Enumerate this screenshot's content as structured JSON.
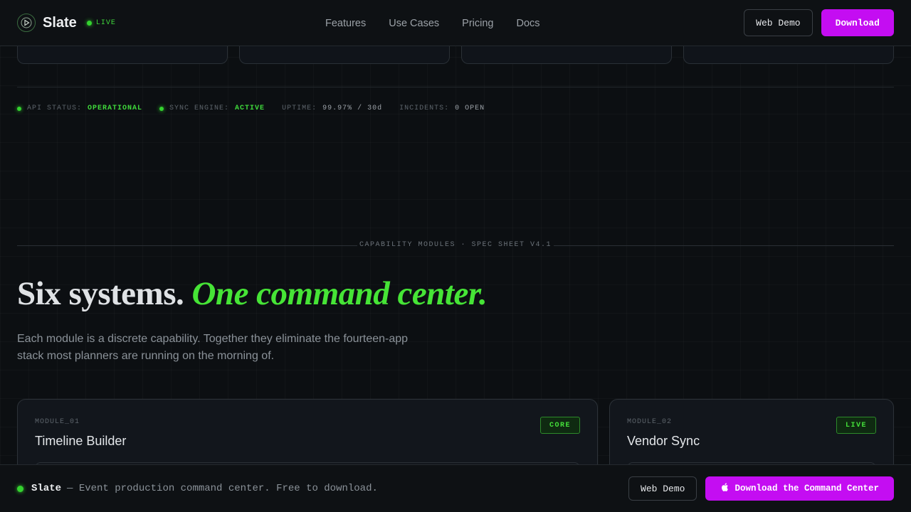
{
  "header": {
    "brand": "Slate",
    "live_label": "LIVE",
    "nav": [
      "Features",
      "Use Cases",
      "Pricing",
      "Docs"
    ],
    "web_demo_label": "Web Demo",
    "download_label": "Download"
  },
  "status": [
    {
      "label": "API STATUS:",
      "value": "OPERATIONAL",
      "dot": true
    },
    {
      "label": "SYNC ENGINE:",
      "value": "ACTIVE",
      "dot": true
    },
    {
      "label": "UPTIME:",
      "value": "99.97% / 30d",
      "dot": false
    },
    {
      "label": "INCIDENTS:",
      "value": "0 OPEN",
      "dot": false
    }
  ],
  "section": {
    "label": "CAPABILITY MODULES · SPEC SHEET V4.1",
    "headline_plain": "Six systems.",
    "headline_accent": "One command center.",
    "subtext": "Each module is a discrete capability. Together they eliminate the fourteen-app stack most planners are running on the morning of."
  },
  "modules": [
    {
      "id": "MODULE_01",
      "title": "Timeline Builder",
      "tag": "CORE"
    },
    {
      "id": "MODULE_02",
      "title": "Vendor Sync",
      "tag": "LIVE"
    }
  ],
  "footer": {
    "brand": "Slate",
    "tagline": "— Event production command center. Free to download.",
    "web_demo_label": "Web Demo",
    "download_label": "Download the Command Center",
    "download_icon": "apple-icon"
  },
  "colors": {
    "accent_green": "#46e436",
    "accent_magenta": "#c40df2",
    "background": "#0c0f12"
  }
}
